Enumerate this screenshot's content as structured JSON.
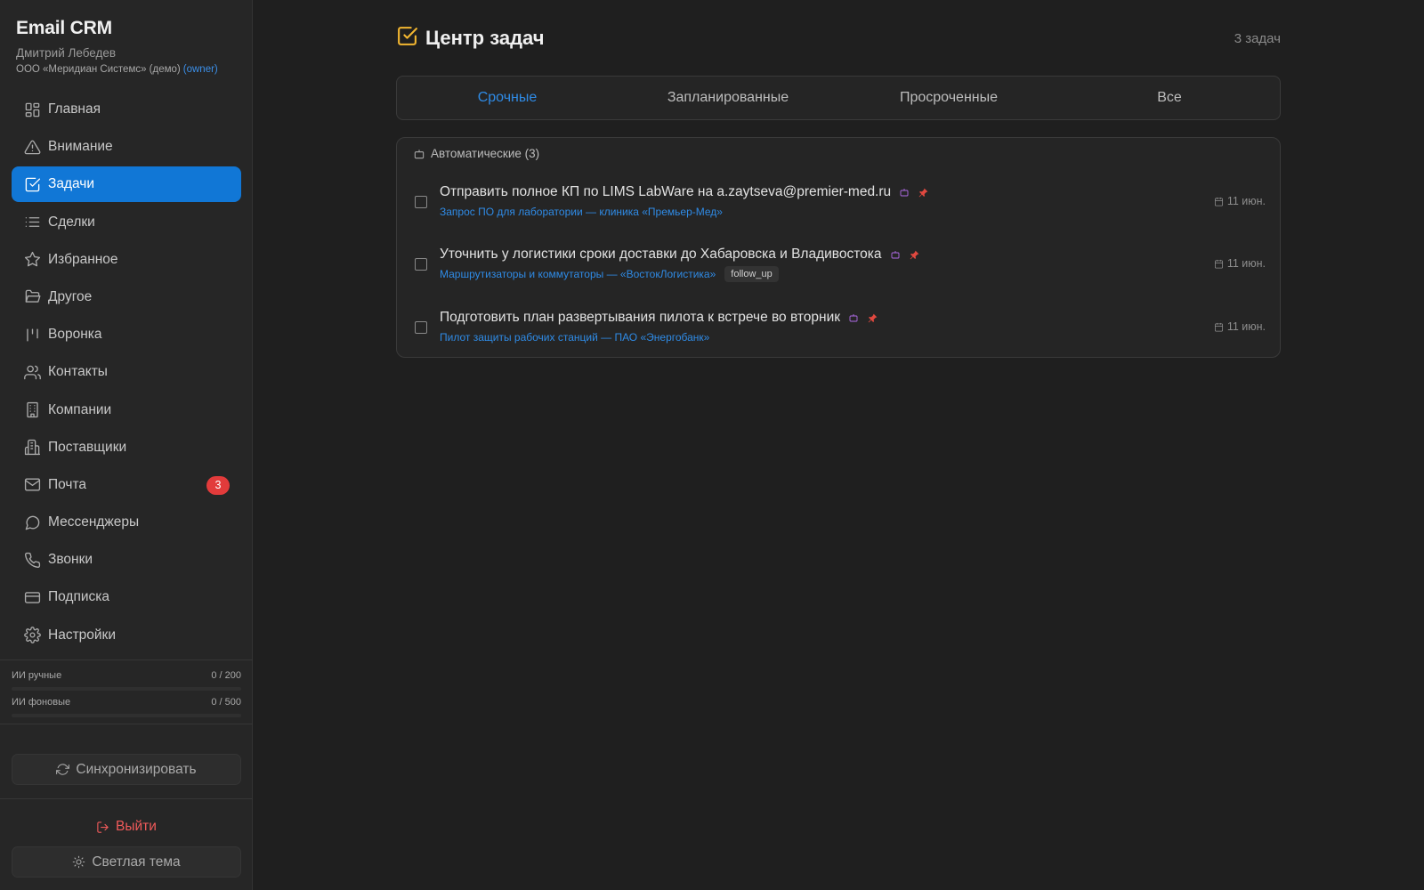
{
  "brand": {
    "app_title": "Email CRM",
    "user_name": "Дмитрий Лебедев",
    "org": "ООО «Меридиан Системс» (демо)",
    "role": "(owner)"
  },
  "nav": {
    "items": [
      {
        "label": "Главная",
        "icon": "grid-icon"
      },
      {
        "label": "Внимание",
        "icon": "warning-icon"
      },
      {
        "label": "Задачи",
        "icon": "checkbox-icon",
        "active": true
      },
      {
        "label": "Сделки",
        "icon": "list-icon"
      },
      {
        "label": "Избранное",
        "icon": "star-icon"
      },
      {
        "label": "Другое",
        "icon": "folder-icon"
      },
      {
        "label": "Воронка",
        "icon": "kanban-icon"
      },
      {
        "label": "Контакты",
        "icon": "users-icon"
      },
      {
        "label": "Компании",
        "icon": "building-icon"
      },
      {
        "label": "Поставщики",
        "icon": "buildings-icon"
      },
      {
        "label": "Почта",
        "icon": "mail-icon",
        "badge": "3"
      },
      {
        "label": "Мессенджеры",
        "icon": "chat-icon"
      },
      {
        "label": "Звонки",
        "icon": "phone-icon"
      },
      {
        "label": "Подписка",
        "icon": "card-icon"
      },
      {
        "label": "Настройки",
        "icon": "gear-icon"
      }
    ]
  },
  "quotas": {
    "manual": {
      "label": "ИИ ручные",
      "value": "0 / 200",
      "fraction": 0
    },
    "background": {
      "label": "ИИ фоновые",
      "value": "0 / 500",
      "fraction": 0
    }
  },
  "actions": {
    "sync": "Синхронизировать",
    "logout": "Выйти",
    "theme": "Светлая тема"
  },
  "header": {
    "title": "Центр задач",
    "count": "3 задач"
  },
  "tabs": [
    {
      "label": "Срочные",
      "active": true
    },
    {
      "label": "Запланированные"
    },
    {
      "label": "Просроченные"
    },
    {
      "label": "Все"
    }
  ],
  "group": {
    "label": "Автоматические (3)"
  },
  "tasks": [
    {
      "title": "Отправить полное КП по LIMS LabWare на a.zaytseva@premier-med.ru",
      "deal": "Запрос ПО для лаборатории — клиника «Премьер-Мед»",
      "tag": "",
      "due": "11 июн."
    },
    {
      "title": "Уточнить у логистики сроки доставки до Хабаровска и Владивостока",
      "deal": "Маршрутизаторы и коммутаторы — «ВостокЛогистика»",
      "tag": "follow_up",
      "due": "11 июн."
    },
    {
      "title": "Подготовить план развертывания пилота к встрече во вторник",
      "deal": "Пилот защиты рабочих станций — ПАО «Энергобанк»",
      "tag": "",
      "due": "11 июн."
    }
  ],
  "colors": {
    "accent": "#1177d6",
    "link": "#2f8be6",
    "danger": "#e23b3b",
    "title_icon": "#f2b630",
    "bot_icon": "#b06ce8"
  }
}
